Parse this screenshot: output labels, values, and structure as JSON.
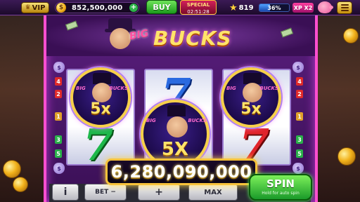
{
  "topbar": {
    "vip_label": "VIP",
    "coins": "852,500,000",
    "coin_plus": "+",
    "buy_label": "BUY",
    "special_label": "SPECIAL",
    "special_timer": "02:51:28",
    "stars": "819",
    "xp_percent_label": "36%",
    "xp_progress": 0.36,
    "xp_multiplier": "XP X2"
  },
  "machine": {
    "logo_big": "BIG",
    "logo_bucks": "BUCKS",
    "badge_brand_left": "BIG",
    "badge_brand_right": "BUCKS",
    "badge_multiplier": "5x",
    "center_badge_multiplier": "5X",
    "seven_glyph": "7",
    "left_line_numbers": [
      "4",
      "2",
      "1",
      "3",
      "5"
    ],
    "right_line_numbers": [
      "4",
      "2",
      "1",
      "3",
      "5"
    ],
    "bag_label": "$"
  },
  "win_amount": "6,280,090,000",
  "controls": {
    "info_label": "i",
    "minus_label": "BET −",
    "plus_label": "+",
    "max_label": "MAX",
    "spin_label": "SPIN",
    "spin_hint": "Hold for auto spin"
  },
  "colors": {
    "frame_neon": "#ff4fd0",
    "gold": "#f6c23a",
    "spin_green": "#1a9a2a"
  }
}
